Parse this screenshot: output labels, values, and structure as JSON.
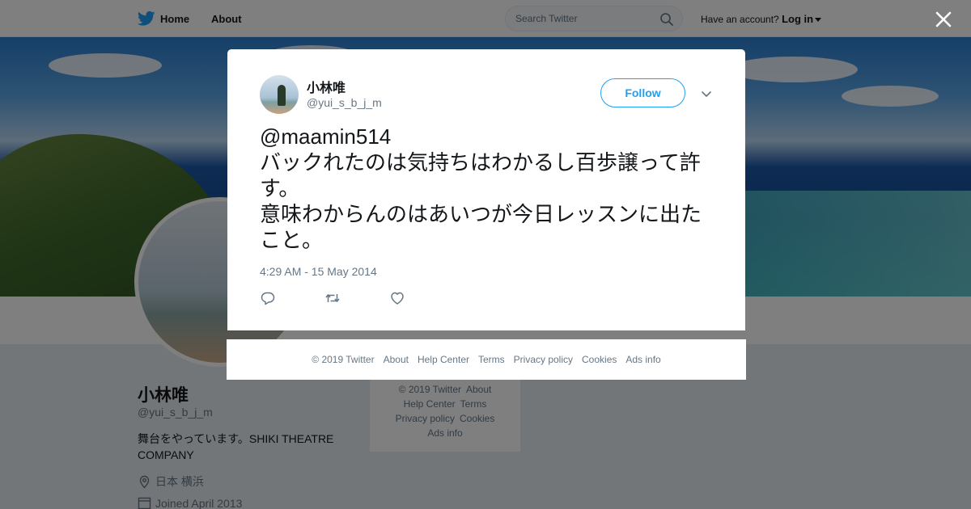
{
  "nav": {
    "home": "Home",
    "about": "About",
    "search_placeholder": "Search Twitter",
    "account_prompt": "Have an account?",
    "login": "Log in"
  },
  "profile": {
    "name": "小林唯",
    "handle": "@yui_s_b_j_m",
    "bio": "舞台をやっています。SHIKI THEATRE COMPANY",
    "location": "日本 横浜",
    "joined": "Joined April 2013"
  },
  "sidebar_footer": {
    "links": [
      "© 2019 Twitter",
      "About",
      "Help Center",
      "Terms",
      "Privacy policy",
      "Cookies",
      "Ads info"
    ]
  },
  "tweet": {
    "name": "小林唯",
    "handle": "@yui_s_b_j_m",
    "follow_label": "Follow",
    "text": "@maamin514\nバックれたのは気持ちはわかるし百歩譲って許す。\n意味わからんのはあいつが今日レッスンに出たこと。",
    "time": "4:29 AM - 15 May 2014"
  },
  "modal_footer": {
    "links": [
      "© 2019 Twitter",
      "About",
      "Help Center",
      "Terms",
      "Privacy policy",
      "Cookies",
      "Ads info"
    ]
  },
  "colors": {
    "accent": "#1da1f2",
    "text": "#14171a",
    "muted": "#657786",
    "overlay": "rgba(0,0,0,0.5)"
  },
  "icons": [
    "twitter-bird-icon",
    "search-icon",
    "close-icon",
    "chevron-down-icon",
    "reply-icon",
    "retweet-icon",
    "like-icon",
    "location-icon",
    "calendar-icon"
  ]
}
